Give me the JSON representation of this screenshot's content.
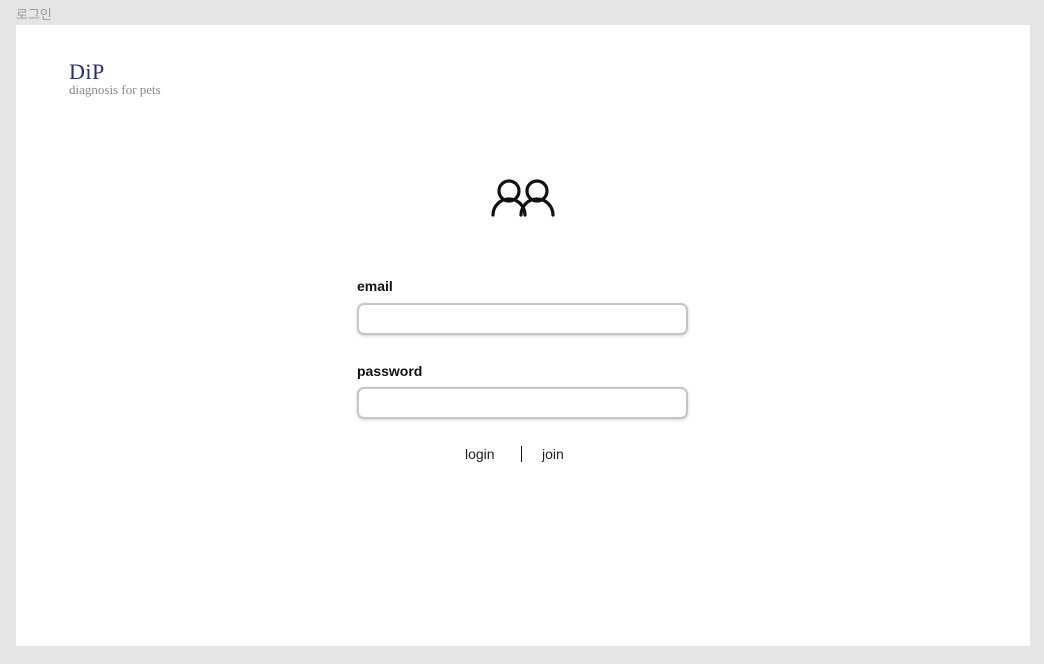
{
  "frame": {
    "label": "로그인"
  },
  "brand": {
    "title": "DiP",
    "subtitle": "diagnosis for pets",
    "color": "#2b2a6b"
  },
  "icon": {
    "name": "users-icon"
  },
  "form": {
    "email_label": "email",
    "email_value": "",
    "password_label": "password",
    "password_value": ""
  },
  "actions": {
    "login_label": "login",
    "join_label": "join"
  }
}
